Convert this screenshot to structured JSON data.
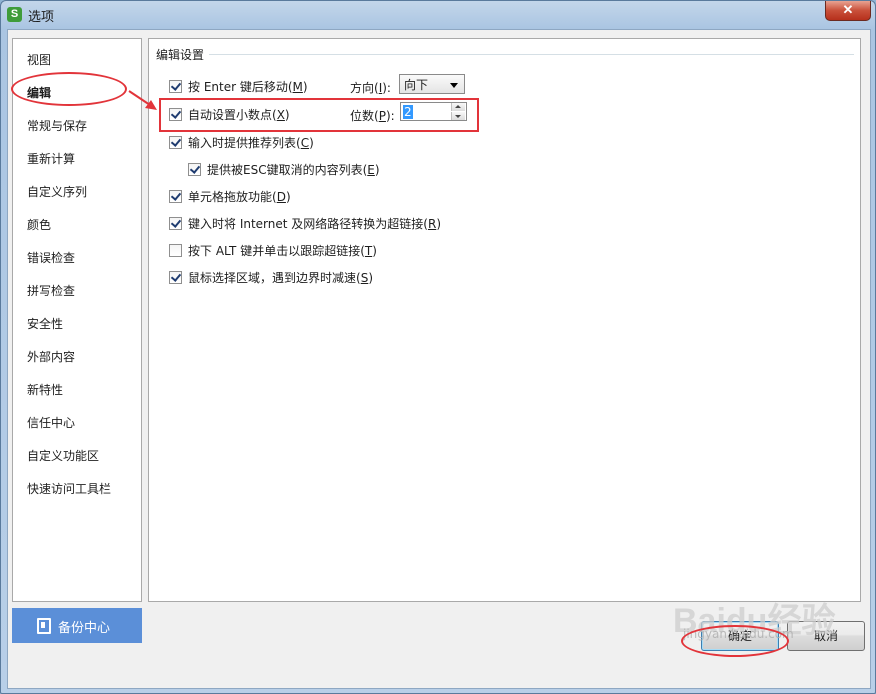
{
  "window": {
    "title": "选项",
    "app_icon_letter": "S",
    "close_glyph": "✕"
  },
  "sidebar": {
    "items": [
      {
        "label": "视图",
        "active": false
      },
      {
        "label": "编辑",
        "active": true
      },
      {
        "label": "常规与保存",
        "active": false
      },
      {
        "label": "重新计算",
        "active": false
      },
      {
        "label": "自定义序列",
        "active": false
      },
      {
        "label": "颜色",
        "active": false
      },
      {
        "label": "错误检查",
        "active": false
      },
      {
        "label": "拼写检查",
        "active": false
      },
      {
        "label": "安全性",
        "active": false
      },
      {
        "label": "外部内容",
        "active": false
      },
      {
        "label": "新特性",
        "active": false
      },
      {
        "label": "信任中心",
        "active": false
      },
      {
        "label": "自定义功能区",
        "active": false
      },
      {
        "label": "快速访问工具栏",
        "active": false
      }
    ],
    "backup_button": {
      "label": "备份中心",
      "icon": "backup-icon"
    }
  },
  "panel": {
    "group_title": "编辑设置",
    "options": [
      {
        "pre": "按 Enter 键后移动(",
        "key": "M",
        "post": ")",
        "checked": true
      },
      {
        "pre": "自动设置小数点(",
        "key": "X",
        "post": ")",
        "checked": true
      },
      {
        "pre": "输入时提供推荐列表(",
        "key": "C",
        "post": ")",
        "checked": true
      },
      {
        "pre": "提供被ESC键取消的内容列表(",
        "key": "E",
        "post": ")",
        "checked": true
      },
      {
        "pre": "单元格拖放功能(",
        "key": "D",
        "post": ")",
        "checked": true
      },
      {
        "pre": "键入时将 Internet 及网络路径转换为超链接(",
        "key": "R",
        "post": ")",
        "checked": true
      },
      {
        "pre": "按下 ALT 键并单击以跟踪超链接(",
        "key": "T",
        "post": ")",
        "checked": false
      },
      {
        "pre": "鼠标选择区域，遇到边界时减速(",
        "key": "S",
        "post": ")",
        "checked": true
      }
    ],
    "direction": {
      "pre": "方向(",
      "key": "I",
      "post": "):",
      "value": "向下"
    },
    "decimal_places": {
      "pre": "位数(",
      "key": "P",
      "post": "):",
      "value": "2"
    }
  },
  "buttons": {
    "ok": "确定",
    "cancel": "取消"
  },
  "watermark": {
    "brand": "Baidu经验",
    "url": "jingyan.baidu.com"
  },
  "annotation_color": "#e2343a"
}
